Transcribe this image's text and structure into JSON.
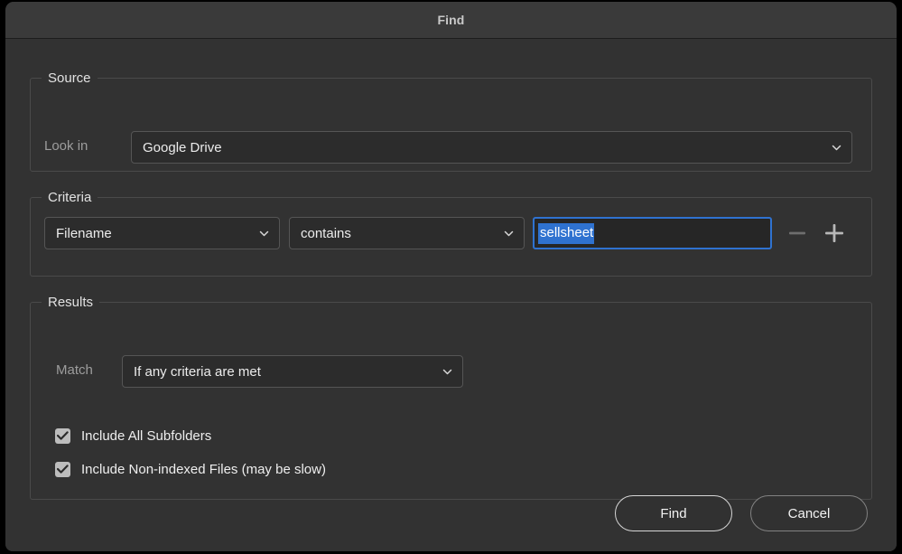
{
  "window": {
    "title": "Find"
  },
  "source": {
    "group_title": "Source",
    "lookin_label": "Look in",
    "lookin_value": "Google Drive",
    "lookin_icon": "chevron-down-icon"
  },
  "criteria": {
    "group_title": "Criteria",
    "field_value": "Filename",
    "operator_value": "contains",
    "search_value": "sellsheet",
    "search_placeholder": "",
    "remove_label": "−",
    "add_label": "+",
    "remove_icon": "minus-icon",
    "add_icon": "plus-icon"
  },
  "results": {
    "group_title": "Results",
    "match_label": "Match",
    "match_value": "If any criteria are met",
    "checkboxes": [
      {
        "label": "Include All Subfolders",
        "checked": true
      },
      {
        "label": "Include Non-indexed Files (may be slow)",
        "checked": true
      }
    ]
  },
  "footer": {
    "find_label": "Find",
    "cancel_label": "Cancel"
  },
  "colors": {
    "window_bg": "#323232",
    "titlebar_bg": "#3a3a3a",
    "field_bg": "#2c2c2c",
    "accent_selection": "#2f72d0",
    "checkbox_fill": "#bdbdbd",
    "label_muted": "#9d9d9d",
    "text_primary": "#ececec"
  }
}
